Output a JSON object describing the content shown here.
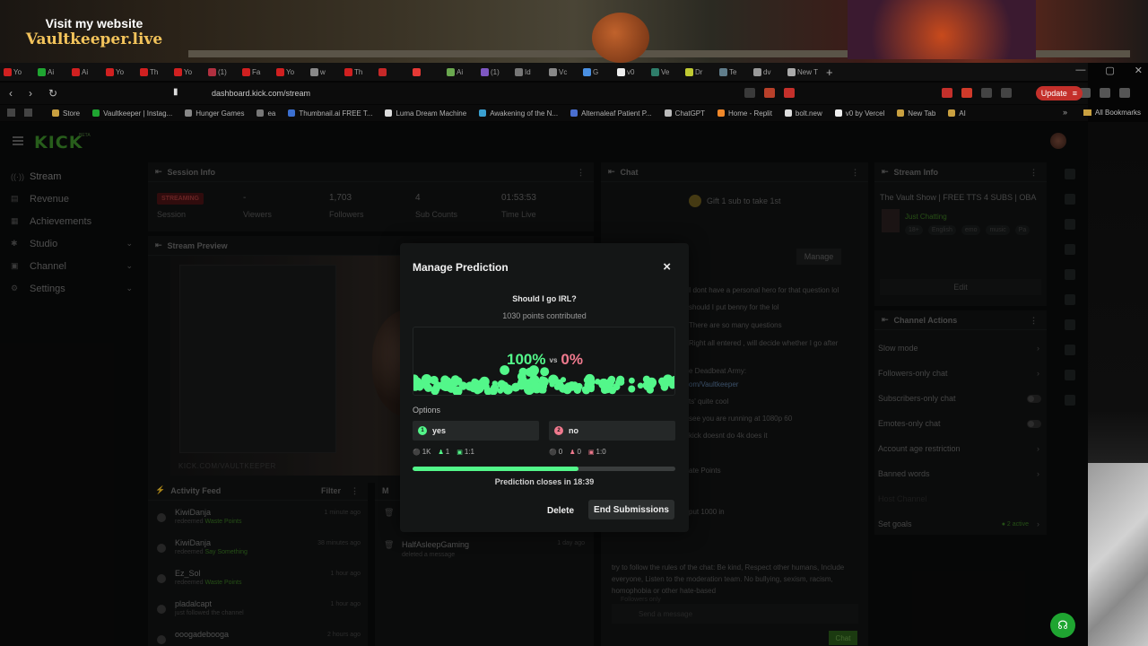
{
  "overlay": {
    "website_line1": "Visit my website",
    "website_line2": "Vaultkeeper.live"
  },
  "browser": {
    "tabs": [
      "Yo",
      "Ai",
      "Ai",
      "Yo",
      "Th",
      "Yo",
      "(1)",
      "Fa",
      "Yo",
      "w",
      "Th",
      "",
      "",
      "Ai",
      "(1)",
      "Id",
      "Vc",
      "G",
      "v0",
      "Ve",
      "Dr",
      "Te",
      "dv",
      "New T"
    ],
    "new_tab": "+",
    "url": "dashboard.kick.com/stream",
    "update_label": "Update",
    "bookmarks": [
      "Store",
      "Vaultkeeper | Instag...",
      "Hunger Games",
      "ea",
      "Thumbnail.ai FREE T...",
      "Luma Dream Machine",
      "Awakening of the N...",
      "Alternaleaf Patient P...",
      "ChatGPT",
      "Home - Replit",
      "bolt.new",
      "v0 by Vercel",
      "New Tab",
      "AI"
    ],
    "all_bookmarks": "All Bookmarks",
    "more": "»"
  },
  "app": {
    "logo": "KICK",
    "logo_badge": "BETA",
    "sidebar": [
      {
        "label": "Stream",
        "icon": "stream-icon",
        "glyph": "((·))"
      },
      {
        "label": "Revenue",
        "icon": "revenue-icon",
        "glyph": "▤"
      },
      {
        "label": "Achievements",
        "icon": "achievements-icon",
        "glyph": "▦"
      },
      {
        "label": "Studio",
        "icon": "studio-icon",
        "glyph": "✱",
        "chevron": "⌄"
      },
      {
        "label": "Channel",
        "icon": "channel-icon",
        "glyph": "▣",
        "chevron": "⌄"
      },
      {
        "label": "Settings",
        "icon": "settings-icon",
        "glyph": "⚙",
        "chevron": "⌄"
      }
    ],
    "session": {
      "title": "Session Info",
      "badge": "STREAMING",
      "badge_caption": "Session",
      "stats": [
        {
          "value": "-",
          "label": "Viewers"
        },
        {
          "value": "1,703",
          "label": "Followers"
        },
        {
          "value": "4",
          "label": "Sub Counts"
        },
        {
          "value": "01:53:53",
          "label": "Time Live"
        }
      ]
    },
    "preview": {
      "title": "Stream Preview",
      "footer": "KICK.COM/VAULTKEEPER"
    },
    "activity": {
      "title": "Activity Feed",
      "filter": "Filter",
      "rows": [
        {
          "name": "KiwiDanja",
          "desc_prefix": "redeemed",
          "desc_highlight": "Waste Points",
          "time": "1 minute ago"
        },
        {
          "name": "KiwiDanja",
          "desc_prefix": "redeemed",
          "desc_highlight": "Say Something",
          "time": "38 minutes ago"
        },
        {
          "name": "Ez_Sol",
          "desc_prefix": "redeemed",
          "desc_highlight": "Waste Points",
          "time": "1 hour ago"
        },
        {
          "name": "pladalcapt",
          "desc_prefix": "just followed the channel",
          "desc_highlight": "",
          "time": "1 hour ago"
        },
        {
          "name": "ooogadebooga",
          "desc_prefix": "",
          "desc_highlight": "",
          "time": "2 hours ago"
        }
      ]
    },
    "mod": {
      "title": "M",
      "name": "HalfAsleepGaming",
      "desc": "deleted a message",
      "time": "1 day ago"
    },
    "chat": {
      "title": "Chat",
      "gift": "Gift 1 sub to take 1st",
      "manage": "Manage",
      "lines": [
        {
          "text": "I dont have a personal hero for that question lol",
          "link": false
        },
        {
          "text": "should I put benny for the lol",
          "link": false
        },
        {
          "text": "There are so many questions",
          "link": false
        },
        {
          "text": "Right all entered , will decide whether I go after",
          "link": false
        },
        {
          "text": "e Deadbeat Army:",
          "link": false
        },
        {
          "text": "om/Vaultkeeper",
          "link": true
        },
        {
          "text": "ts' quite cool",
          "link": false
        },
        {
          "text": "see you are running at 1080p 60",
          "link": false
        },
        {
          "text": "kick doesnt do 4k does it",
          "link": false
        },
        {
          "text": "ate Points",
          "link": false
        },
        {
          "text": "put 1000 in",
          "link": false
        }
      ],
      "rules": "try to follow the rules of the chat: Be kind, Respect other humans, Include everyone, Listen to the moderation team. No bullying, sexism, racism, homophobia or other hate-based",
      "followers_only": "Followers only",
      "input_placeholder": "Send a message",
      "send": "Chat"
    },
    "stream_info": {
      "title": "Stream Info",
      "stream_title": "The Vault Show | FREE TTS 4 SUBS | OBA",
      "category": "Just Chatting",
      "tags": [
        "18+",
        "English",
        "emo",
        "music",
        "Pa"
      ],
      "edit": "Edit"
    },
    "channel_actions": {
      "title": "Channel Actions",
      "rows": [
        {
          "label": "Slow mode",
          "kind": "chevron"
        },
        {
          "label": "Followers-only chat",
          "kind": "chevron"
        },
        {
          "label": "Subscribers-only chat",
          "kind": "toggle"
        },
        {
          "label": "Emotes-only chat",
          "kind": "toggle"
        },
        {
          "label": "Account age restriction",
          "kind": "chevron"
        },
        {
          "label": "Banned words",
          "kind": "chevron"
        },
        {
          "label": "Host Channel",
          "kind": "none"
        },
        {
          "label": "Set goals",
          "kind": "chevron",
          "badge": "● 2 active"
        }
      ]
    }
  },
  "modal": {
    "title": "Manage Prediction",
    "close": "×",
    "question": "Should I go IRL?",
    "points": "1030 points contributed",
    "pct_yes": "100%",
    "vs": "vs",
    "pct_no": "0%",
    "options_label": "Options",
    "options": [
      {
        "num": "1",
        "label": "yes",
        "points": "1K",
        "users": "1",
        "ratio": "1:1"
      },
      {
        "num": "2",
        "label": "no",
        "points": "0",
        "users": "0",
        "ratio": "1:0"
      }
    ],
    "progress": 0.63,
    "closes": "Prediction closes in 18:39",
    "delete": "Delete",
    "end": "End Submissions"
  },
  "colors": {
    "yes": "#53f78a",
    "no": "#f07a8e",
    "kick_green": "#53fc18"
  }
}
